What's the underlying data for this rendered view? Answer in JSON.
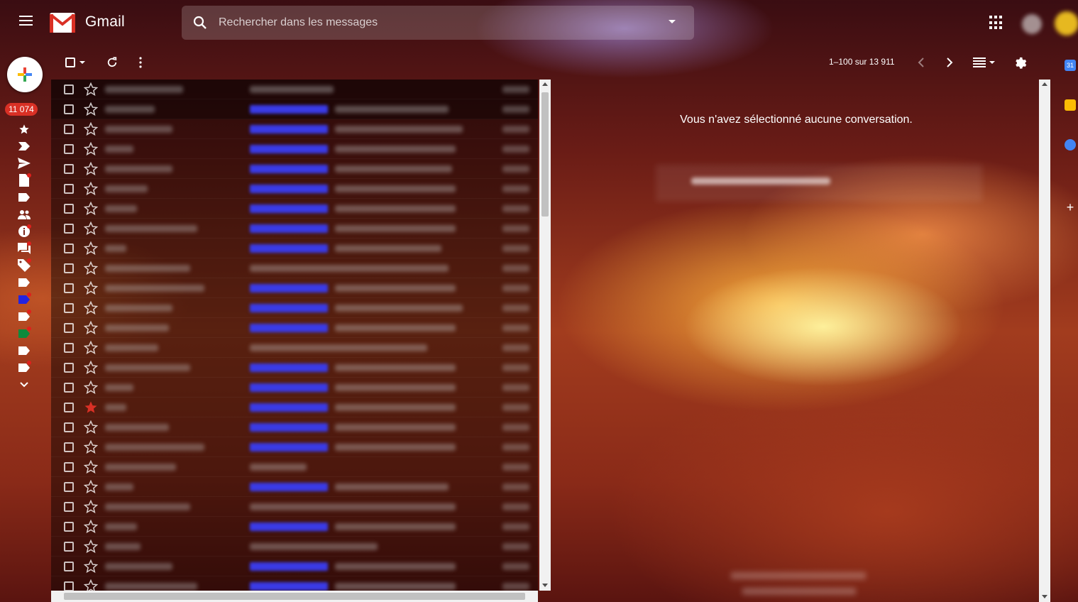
{
  "header": {
    "brand": "Gmail",
    "search_placeholder": "Rechercher dans les messages"
  },
  "sidebar": {
    "unread_count": "11 074",
    "icons": [
      "star-icon",
      "snoozed-icon",
      "sent-icon",
      "drafts-icon",
      "label-icon",
      "social-icon",
      "updates-icon",
      "forums-icon",
      "promotions-icon",
      "label-icon",
      "label-blue-icon",
      "label-icon",
      "label-green-icon",
      "label-icon",
      "label-icon",
      "more-chevron-icon"
    ]
  },
  "toolbar": {
    "pager_text": "1–100 sur 13 911"
  },
  "preview": {
    "empty_message": "Vous n'avez sélectionné aucune conversation."
  },
  "side_panel": {
    "calendar_day": "31"
  },
  "colors": {
    "accent_red": "#d93025",
    "label_blue": "#3a3be6"
  }
}
